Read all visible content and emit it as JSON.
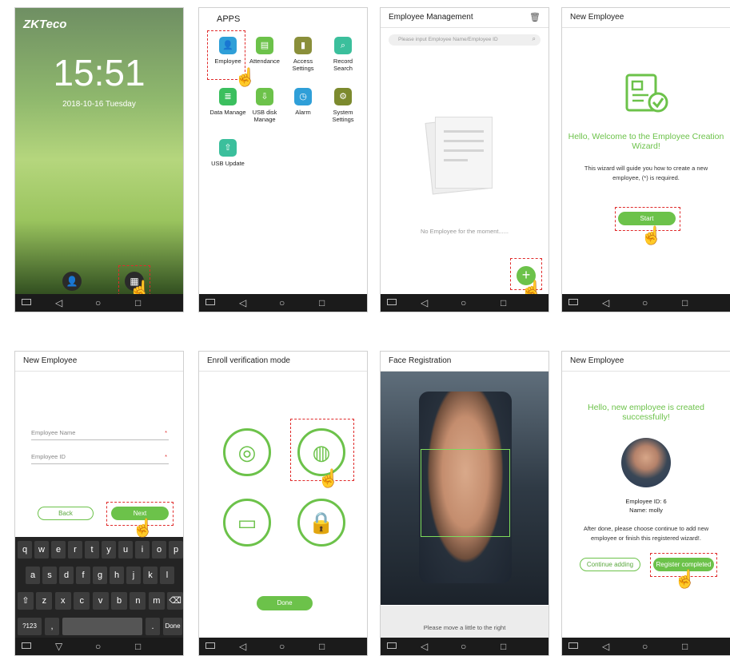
{
  "nav": {
    "back": "◁",
    "home": "○",
    "recent": "□"
  },
  "lock": {
    "logo": "ZKTeco",
    "time": "15:51",
    "date": "2018-10-16   Tuesday"
  },
  "apps": {
    "title": "APPS",
    "items": [
      {
        "label": "Employee",
        "color": "#2f9fd8",
        "icon": "person-icon"
      },
      {
        "label": "Attendance",
        "color": "#6cc24a",
        "icon": "calendar-icon"
      },
      {
        "label": "Access Settings",
        "color": "#8a8f3a",
        "icon": "door-icon"
      },
      {
        "label": "Record Search",
        "color": "#3bbf9c",
        "icon": "search-doc-icon"
      },
      {
        "label": "Data Manage",
        "color": "#3bbf5e",
        "icon": "database-icon"
      },
      {
        "label": "USB disk Manage",
        "color": "#6cc24a",
        "icon": "usb-icon"
      },
      {
        "label": "Alarm",
        "color": "#2f9fd8",
        "icon": "clock-icon"
      },
      {
        "label": "System Settings",
        "color": "#7c8a2e",
        "icon": "gear-icon"
      },
      {
        "label": "USB Update",
        "color": "#3bbf9c",
        "icon": "usb-update-icon"
      }
    ]
  },
  "emp_mgmt": {
    "title": "Employee Management",
    "search_placeholder": "Please input Employee Name/Employee ID",
    "empty": "No Employee for the moment......"
  },
  "new_emp": {
    "title": "New Employee",
    "welcome": "Hello, Welcome to the Employee Creation Wizard!",
    "desc": "This wizard will guide you how to create a new employee,  (*)  is required.",
    "start": "Start"
  },
  "form": {
    "title": "New Employee",
    "name_placeholder": "Employee Name",
    "id_placeholder": "Employee ID",
    "required": "*",
    "back": "Back",
    "next": "Next",
    "kb_row1": [
      "q",
      "w",
      "e",
      "r",
      "t",
      "y",
      "u",
      "i",
      "o",
      "p"
    ],
    "kb_row2": [
      "a",
      "s",
      "d",
      "f",
      "g",
      "h",
      "j",
      "k",
      "l"
    ],
    "kb_row3": [
      "⇧",
      "z",
      "x",
      "c",
      "v",
      "b",
      "n",
      "m",
      "⌫"
    ],
    "kb_num": "?123",
    "kb_comma": ",",
    "kb_dot": ".",
    "kb_done": "Done"
  },
  "enroll": {
    "title": "Enroll verification mode",
    "done": "Done"
  },
  "face": {
    "title": "Face Registration",
    "hint": "Please move a little to the right"
  },
  "done_screen": {
    "title": "New Employee",
    "heading": "Hello, new employee is created successfully!",
    "emp_id": "Employee ID:  6",
    "name": "Name:  molly",
    "desc": "After done, please choose continue to add new employee or finish this registered wizard!.",
    "continue": "Continue adding",
    "complete": "Register completed"
  }
}
